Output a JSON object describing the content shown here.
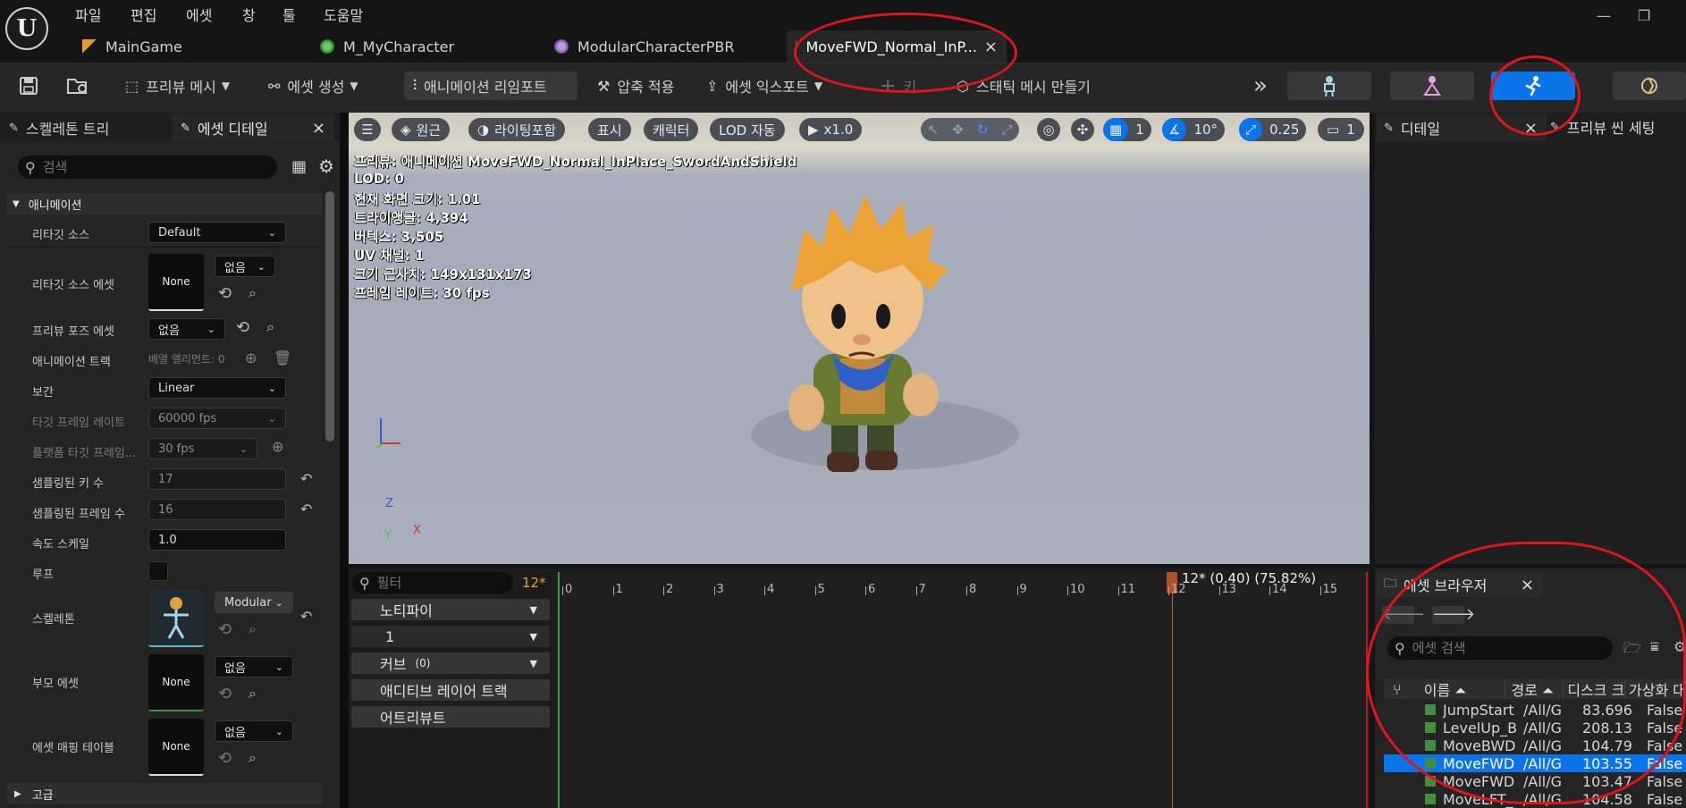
{
  "menu": [
    "파일",
    "편집",
    "에셋",
    "창",
    "툴",
    "도움말"
  ],
  "tabs": [
    {
      "label": "MainGame",
      "icon": "level-icon"
    },
    {
      "label": "M_MyCharacter",
      "icon": "material-icon"
    },
    {
      "label": "ModularCharacterPBR",
      "icon": "material-instance-icon"
    },
    {
      "label": "MoveFWD_Normal_InP...",
      "icon": "animation-icon"
    }
  ],
  "tab_close": "×",
  "window": {
    "minimize": "—",
    "restore": "❐"
  },
  "toolbar": {
    "preview_mesh": "프리뷰 메시",
    "create_asset": "에셋 생성",
    "reimport": "애니메이션 리임포트",
    "apply_compression": "압축 적용",
    "export_asset": "에셋 익스포트",
    "key": "키",
    "make_static_mesh": "스태틱 메시 만들기",
    "more": "»"
  },
  "left_tabs": {
    "skeleton_tree": "스켈레톤 트리",
    "asset_details": "에셋 디테일",
    "close": "×"
  },
  "search": {
    "placeholder": "검색"
  },
  "animation_section": "애니메이션",
  "props": {
    "retarget_source": {
      "label": "리타깃 소스",
      "value": "Default"
    },
    "retarget_source_asset": {
      "label": "리타깃 소스 에셋",
      "thumb": "None",
      "value": "없음"
    },
    "preview_pose_asset": {
      "label": "프리뷰 포즈 에셋",
      "value": "없음"
    },
    "animation_track": {
      "label": "애니메이션 트랙",
      "value": "배열 엘리먼트: 0"
    },
    "interpolation": {
      "label": "보간",
      "value": "Linear"
    },
    "target_frame_rate": {
      "label": "타깃 프레임 레이트",
      "value": "60000 fps"
    },
    "platform_target_frame": {
      "label": "플랫폼 타깃 프레임...",
      "value": "30 fps"
    },
    "sampled_keys": {
      "label": "샘플링된 키 수",
      "value": "17"
    },
    "sampled_frames": {
      "label": "샘플링된 프레임 수",
      "value": "16"
    },
    "rate_scale": {
      "label": "속도 스케일",
      "value": "1.0"
    },
    "loop": {
      "label": "루프"
    },
    "skeleton": {
      "label": "스켈레톤",
      "value": "Modular"
    },
    "parent_asset": {
      "label": "부모 에셋",
      "thumb": "None",
      "value": "없음"
    },
    "asset_mapping_table": {
      "label": "에셋 매핑 테이블",
      "thumb": "None",
      "value": "없음"
    },
    "advanced": "고급"
  },
  "viewport": {
    "buttons": {
      "lit": "원근",
      "lighting": "라이팅포함",
      "show": "표시",
      "character": "캐릭터",
      "lod": "LOD 자동",
      "speed": "x1.0",
      "grid_snap": "1",
      "angle_snap": "10°",
      "scale_snap": "0.25",
      "camera_speed": "1"
    },
    "stats": [
      "프리뷰: 애니메이션 MoveFWD_Normal_InPlace_SwordAndShield",
      "LOD: 0",
      "현재 화면 크기: 1.01",
      "트라이앵글: 4,394",
      "버텍스: 3,505",
      "UV 채널: 1",
      "크기 근사치: 149x131x173",
      "프레임 레이트: 30 fps"
    ],
    "axes": {
      "z": "Z",
      "y": "Y",
      "x": "X"
    }
  },
  "timeline": {
    "filter_placeholder": "필터",
    "current_frame_badge": "12*",
    "tracks": [
      "노티파이",
      "1",
      "커브",
      "애디티브 레이어 트랙",
      "어트리뷰트"
    ],
    "curve_count": "(0)",
    "ticks": [
      "0",
      "1",
      "2",
      "3",
      "4",
      "5",
      "6",
      "7",
      "8",
      "9",
      "10",
      "11",
      "12",
      "13",
      "14",
      "15"
    ],
    "playhead_label": "12* (0.40) (75.82%)"
  },
  "right": {
    "details": "디테일",
    "preview_scene": "프리뷰 씬 세팅",
    "close": "×"
  },
  "asset_browser": {
    "title": "에셋 브라우저",
    "close": "×",
    "search_placeholder": "에셋 검색",
    "columns": [
      "이름",
      "경로",
      "디스크 크",
      "가상화 대"
    ],
    "rows": [
      {
        "name": "JumpStart",
        "path": "/All/G",
        "size": "83.696",
        "virt": "False",
        "selected": false
      },
      {
        "name": "LevelUp_B",
        "path": "/All/G",
        "size": "208.13",
        "virt": "False",
        "selected": false
      },
      {
        "name": "MoveBWD",
        "path": "/All/G",
        "size": "104.79",
        "virt": "False",
        "selected": false
      },
      {
        "name": "MoveFWD",
        "path": "/All/G",
        "size": "103.55",
        "virt": "False",
        "selected": true
      },
      {
        "name": "MoveFWD",
        "path": "/All/G",
        "size": "103.47",
        "virt": "False",
        "selected": false
      },
      {
        "name": "MoveLFT_",
        "path": "/All/G",
        "size": "104.58",
        "virt": "False",
        "selected": false
      }
    ]
  },
  "colors": {
    "accent": "#0a74e8",
    "timeline_badge": "#e0a020",
    "annotation": "#e0141a"
  }
}
